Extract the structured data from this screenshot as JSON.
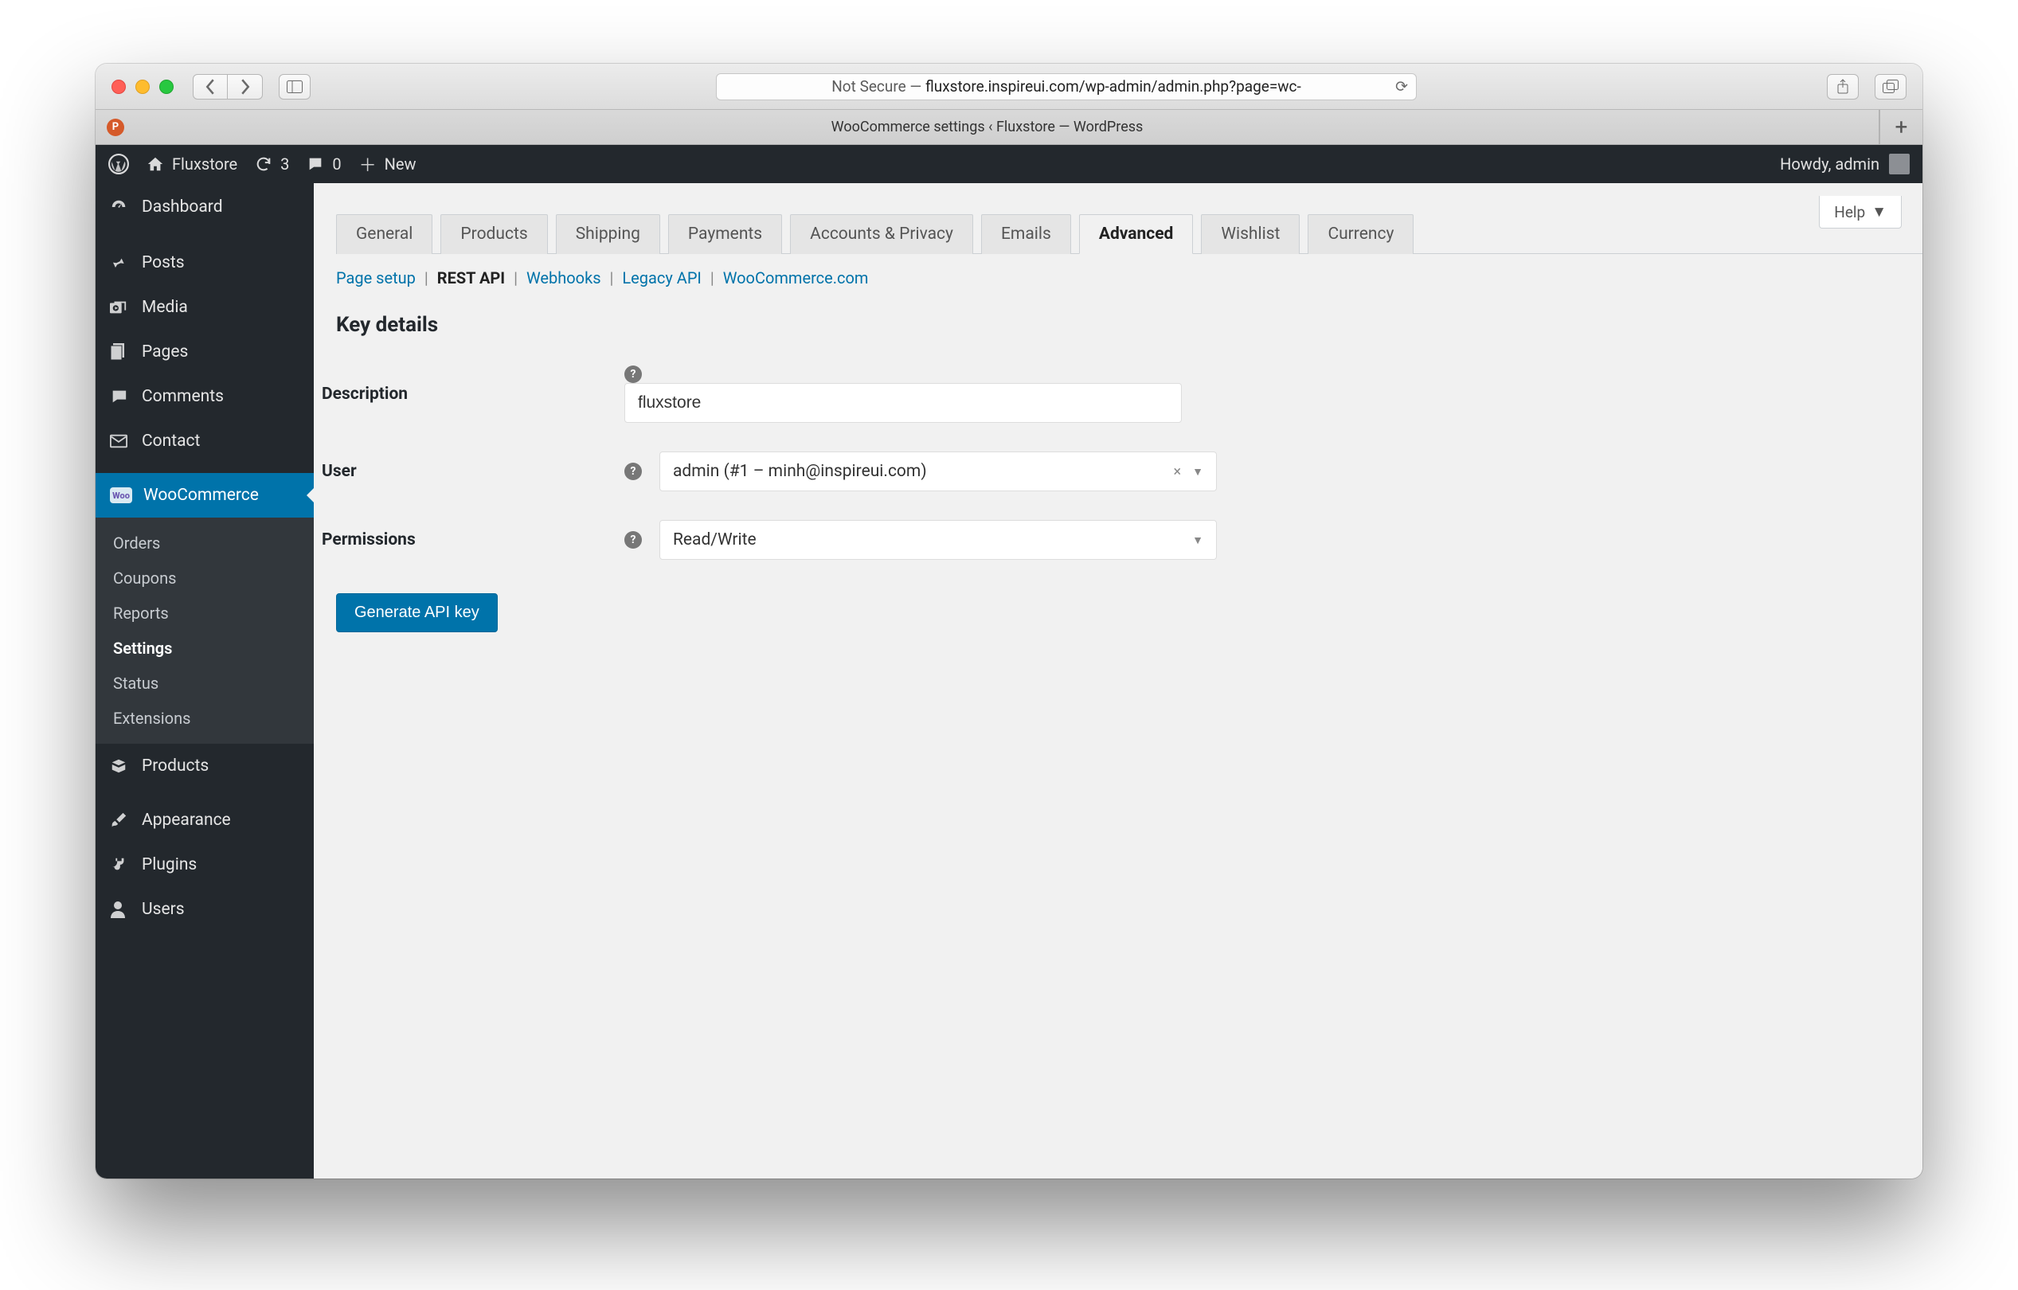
{
  "browser": {
    "url_prefix": "Not Secure — ",
    "url": "fluxstore.inspireui.com/wp-admin/admin.php?page=wc-",
    "tab_title": "WooCommerce settings ‹ Fluxstore — WordPress",
    "favicon_letter": "P"
  },
  "adminbar": {
    "site_name": "Fluxstore",
    "updates_count": "3",
    "comments_count": "0",
    "new_label": "New",
    "howdy": "Howdy, admin"
  },
  "sidebar": {
    "items": [
      {
        "label": "Dashboard"
      },
      {
        "label": "Posts"
      },
      {
        "label": "Media"
      },
      {
        "label": "Pages"
      },
      {
        "label": "Comments"
      },
      {
        "label": "Contact"
      },
      {
        "label": "WooCommerce"
      },
      {
        "label": "Products"
      },
      {
        "label": "Appearance"
      },
      {
        "label": "Plugins"
      },
      {
        "label": "Users"
      }
    ],
    "woocommerce_submenu": [
      {
        "label": "Orders"
      },
      {
        "label": "Coupons"
      },
      {
        "label": "Reports"
      },
      {
        "label": "Settings"
      },
      {
        "label": "Status"
      },
      {
        "label": "Extensions"
      }
    ]
  },
  "content": {
    "help_label": "Help",
    "tabs": [
      {
        "label": "General"
      },
      {
        "label": "Products"
      },
      {
        "label": "Shipping"
      },
      {
        "label": "Payments"
      },
      {
        "label": "Accounts & Privacy"
      },
      {
        "label": "Emails"
      },
      {
        "label": "Advanced"
      },
      {
        "label": "Wishlist"
      },
      {
        "label": "Currency"
      }
    ],
    "subnav": [
      {
        "label": "Page setup"
      },
      {
        "label": "REST API"
      },
      {
        "label": "Webhooks"
      },
      {
        "label": "Legacy API"
      },
      {
        "label": "WooCommerce.com"
      }
    ],
    "section_title": "Key details",
    "form": {
      "description_label": "Description",
      "description_value": "fluxstore",
      "user_label": "User",
      "user_value": "admin (#1 – minh@inspireui.com)",
      "permissions_label": "Permissions",
      "permissions_value": "Read/Write"
    },
    "submit_label": "Generate API key"
  }
}
